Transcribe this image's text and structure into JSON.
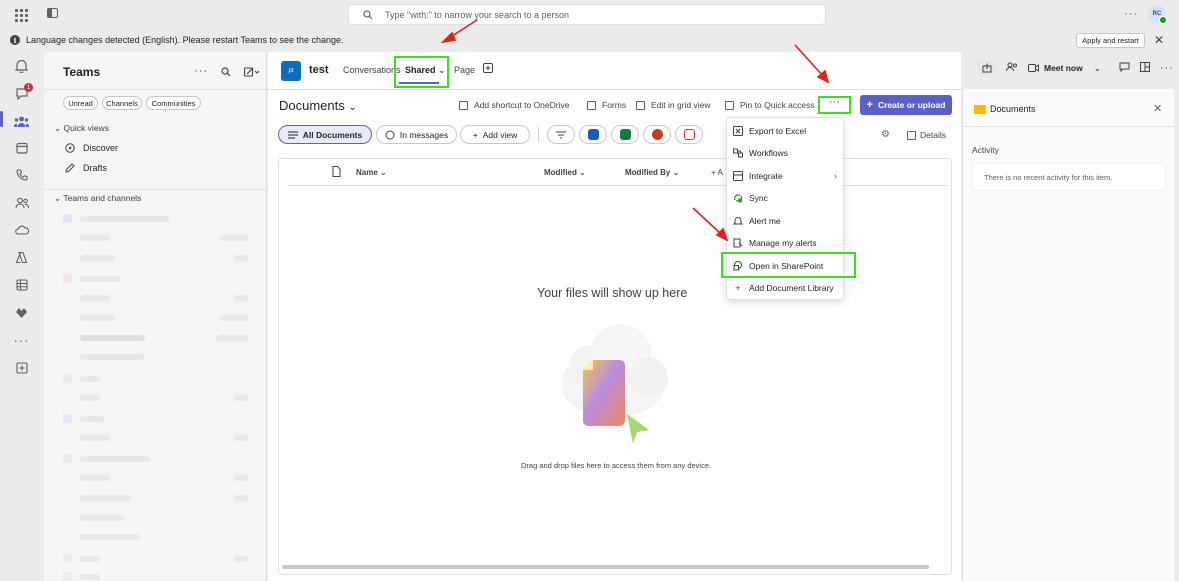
{
  "titlebar": {
    "search_placeholder": "Type \"with:\" to narrow your search to a person",
    "avatar_initials": "RC"
  },
  "notice": {
    "text": "Language changes detected (English). Please restart Teams to see the change.",
    "apply_label": "Apply and restart"
  },
  "rail": {
    "activity_badge": "1"
  },
  "teams_pane": {
    "title": "Teams",
    "filters": [
      "Unread",
      "Channels",
      "Communities"
    ],
    "quick_views_label": "Quick views",
    "discover_label": "Discover",
    "drafts_label": "Drafts",
    "teams_channels_label": "Teams and channels"
  },
  "channel": {
    "avatar": "pt",
    "name": "test",
    "tabs": {
      "conversations": "Conversations",
      "shared": "Shared",
      "page": "Page"
    },
    "meet_now": "Meet now"
  },
  "documents": {
    "title": "Documents",
    "commands": {
      "add_shortcut": "Add shortcut to OneDrive",
      "forms": "Forms",
      "grid_view": "Edit in grid view",
      "pin_quick": "Pin to Quick access",
      "more": "···",
      "create_upload": "Create or upload"
    },
    "views": {
      "all_documents": "All Documents",
      "in_messages": "In messages",
      "add_view": "Add view",
      "details": "Details"
    },
    "columns": {
      "name": "Name",
      "modified": "Modified",
      "modified_by": "Modified By",
      "add": "+ A"
    },
    "empty_title": "Your files will show up here",
    "empty_sub": "Drag and drop files here to access them from any device."
  },
  "menu": {
    "items": [
      "Export to Excel",
      "Workflows",
      "Integrate",
      "Sync",
      "Alert me",
      "Manage my alerts",
      "Open in SharePoint",
      "Add Document Library"
    ]
  },
  "right_pane": {
    "title": "Documents",
    "activity_label": "Activity",
    "empty_activity": "There is no recent activity for this item."
  },
  "colors": {
    "accent": "#5b5fc7",
    "highlight": "#37e21b",
    "arrow": "#e0211b"
  }
}
